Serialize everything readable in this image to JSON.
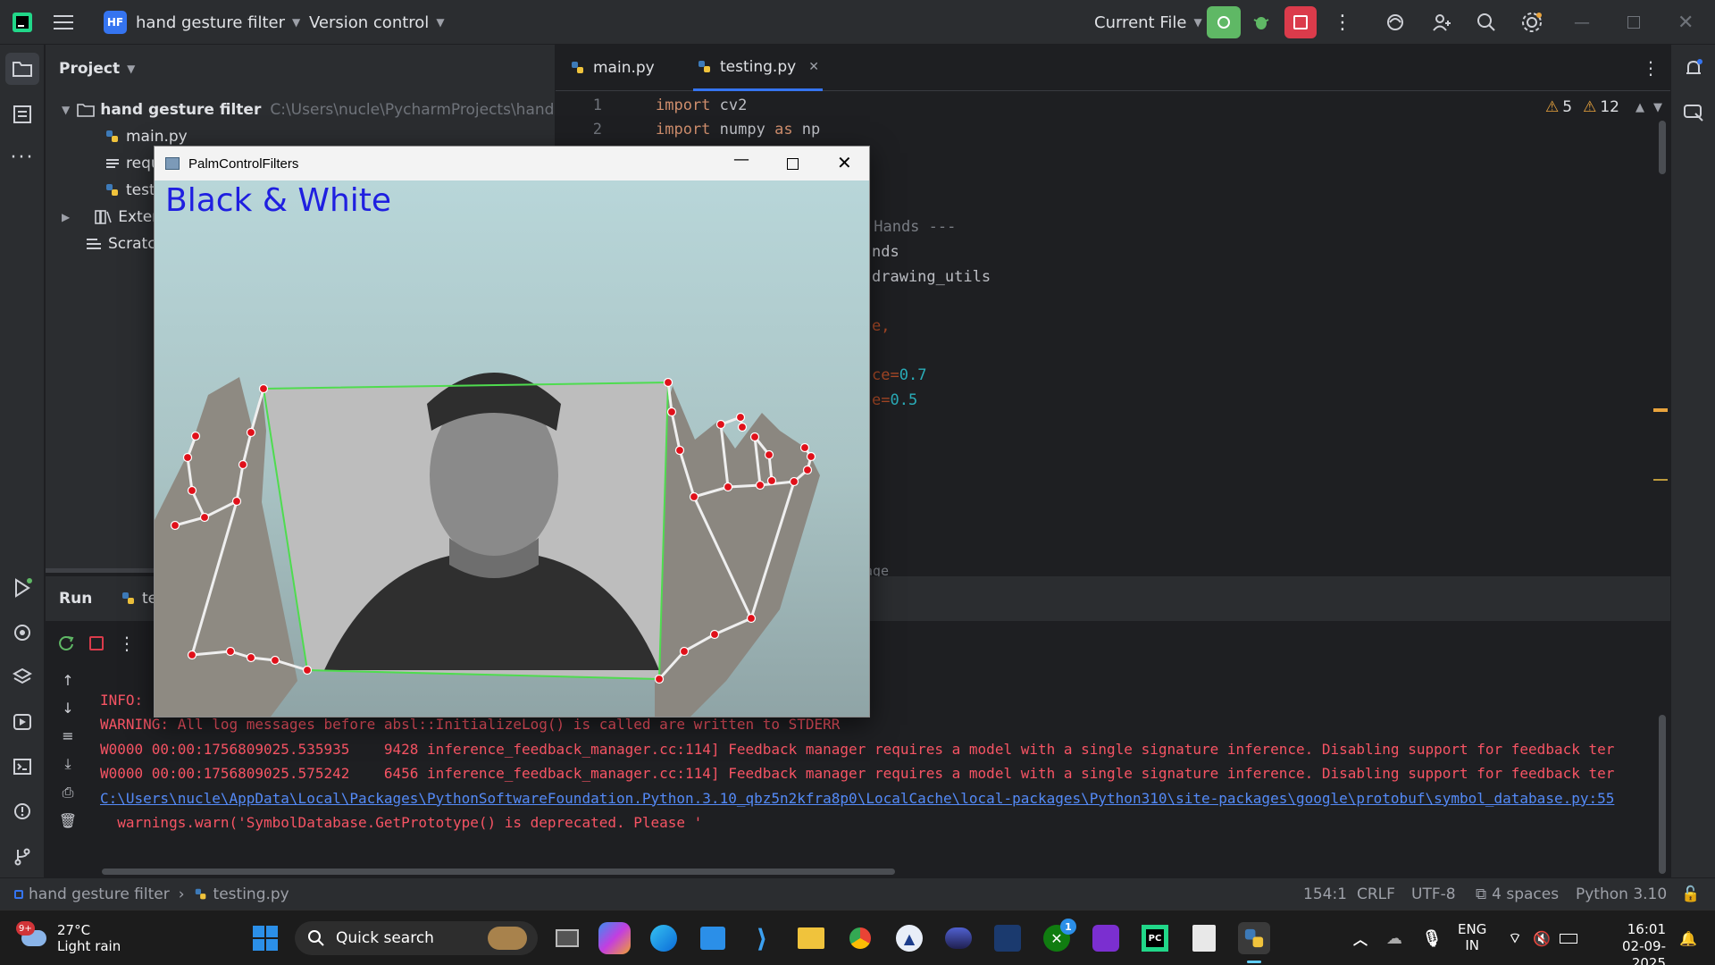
{
  "titlebar": {
    "project_badge": "HF",
    "project_name": "hand gesture filter",
    "version_control": "Version control",
    "run_config": "Current File"
  },
  "project_panel": {
    "title": "Project",
    "root_name": "hand gesture filter",
    "root_path": "C:\\Users\\nucle\\PycharmProjects\\hand gestu",
    "items": [
      {
        "label": "main.py"
      },
      {
        "label": "requ"
      },
      {
        "label": "testi"
      },
      {
        "label": "Externa"
      },
      {
        "label": "Scratch"
      }
    ]
  },
  "editor": {
    "tabs": [
      {
        "label": "main.py"
      },
      {
        "label": "testing.py"
      }
    ],
    "inspections": {
      "warnings_a": "5",
      "warnings_b": "12"
    },
    "lines": [
      {
        "no": "1",
        "kw": "import",
        "rest": " cv2"
      },
      {
        "no": "2",
        "kw": "import",
        "rest": " numpy ",
        "kw2": "as",
        "rest2": " np"
      }
    ],
    "fragments": {
      "hands_comment": " Hands ---",
      "nds": "nds",
      "drawing_utils": "drawing_utils",
      "e_comma": "e,",
      "ce_prefix": "ce=",
      "ce_value": "0.7",
      "e_prefix": "e=",
      "e_value": "0.5",
      "age": "age"
    }
  },
  "run_panel": {
    "title": "Run",
    "tab_label": "te",
    "console": [
      {
        "text": "INFO: ",
        "style": "red"
      },
      {
        "text": "WARNING: All log messages before absl::InitializeLog() is called are written to STDERR",
        "style": "red"
      },
      {
        "text": "W0000 00:00:1756809025.535935    9428 inference_feedback_manager.cc:114] Feedback manager requires a model with a single signature inference. Disabling support for feedback ter",
        "style": "red"
      },
      {
        "text": "W0000 00:00:1756809025.575242    6456 inference_feedback_manager.cc:114] Feedback manager requires a model with a single signature inference. Disabling support for feedback ter",
        "style": "red"
      },
      {
        "text": "C:\\Users\\nucle\\AppData\\Local\\Packages\\PythonSoftwareFoundation.Python.3.10_qbz5n2kfra8p0\\LocalCache\\local-packages\\Python310\\site-packages\\google\\protobuf\\symbol_database.py:55",
        "style": "link"
      },
      {
        "text": "  warnings.warn('SymbolDatabase.GetPrototype() is deprecated. Please '",
        "style": "red"
      }
    ]
  },
  "statusbar": {
    "breadcrumb_project": "hand gesture filter",
    "breadcrumb_file": "testing.py",
    "position": "154:1",
    "line_ending": "CRLF",
    "encoding": "UTF-8",
    "indent": "4 spaces",
    "interpreter": "Python 3.10"
  },
  "camera_window": {
    "title": "PalmControlFilters",
    "overlay_text": "Black & White",
    "overlay_color": "#1f1fe0",
    "frame_color": "#4fdc4f",
    "landmark_color": "#e0101a"
  },
  "taskbar": {
    "weather_temp": "27°C",
    "weather_desc": "Light rain",
    "weather_badge": "9+",
    "search_label": "Quick search",
    "lang_top": "ENG",
    "lang_bottom": "IN",
    "time": "16:01",
    "date": "02-09-2025",
    "xbox_badge": "1"
  },
  "colors": {
    "accent": "#3574f0",
    "run_green": "#5fb865",
    "stop_red": "#db3b4b"
  }
}
